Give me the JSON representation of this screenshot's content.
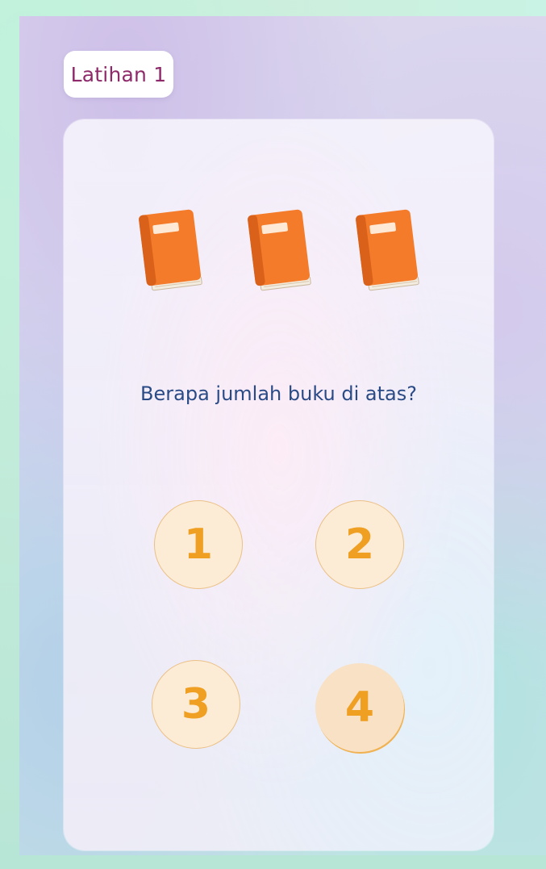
{
  "header": {
    "title": "Latihan 1"
  },
  "question": {
    "items": [
      {
        "icon": "book-icon"
      },
      {
        "icon": "book-icon"
      },
      {
        "icon": "book-icon"
      }
    ],
    "text": "Berapa jumlah buku di atas?"
  },
  "answers": [
    {
      "label": "1",
      "selected": false
    },
    {
      "label": "2",
      "selected": false
    },
    {
      "label": "3",
      "selected": false
    },
    {
      "label": "4",
      "selected": true
    }
  ],
  "colors": {
    "title_text": "#8e2a6a",
    "question_text": "#2a4a86",
    "answer_digit": "#ef9f22",
    "answer_fill": "#fcecd6",
    "book_cover": "#f47b2a"
  }
}
